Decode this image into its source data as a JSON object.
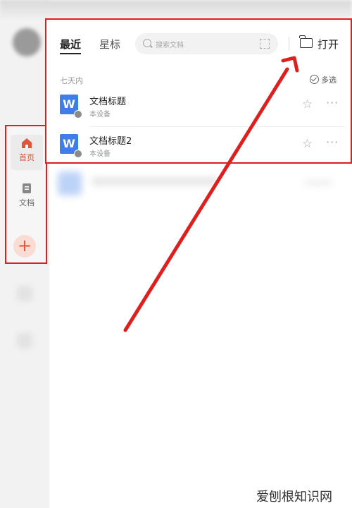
{
  "tabs": {
    "recent": "最近",
    "starred": "星标"
  },
  "search": {
    "placeholder": "搜索文档"
  },
  "open_label": "打开",
  "section": {
    "label": "七天内",
    "multi_select": "多选"
  },
  "files": [
    {
      "title": "文档标题",
      "location": "本设备",
      "icon_letter": "W"
    },
    {
      "title": "文档标题2",
      "location": "本设备",
      "icon_letter": "W"
    }
  ],
  "nav": {
    "home": "首页",
    "docs": "文档",
    "add": "+"
  },
  "watermark": "爱刨根知识网",
  "colors": {
    "highlight": "#e01e1e",
    "accent": "#e5523a",
    "doc_blue": "#3f7ee8"
  }
}
